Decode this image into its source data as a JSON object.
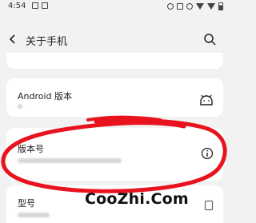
{
  "status_bar": {
    "time": "4:54"
  },
  "header": {
    "title": "关于手机"
  },
  "items": [
    {
      "label": "Android 版本"
    },
    {
      "label": "版本号"
    },
    {
      "label": "型号"
    }
  ],
  "watermark": "CooZhi.Com",
  "colors": {
    "annotation": "#e8131f",
    "background": "#f2f2f2",
    "card": "#ffffff"
  }
}
